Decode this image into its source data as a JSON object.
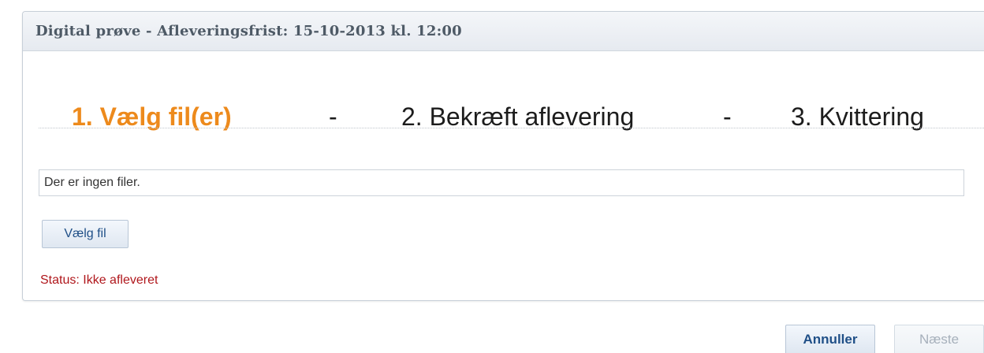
{
  "dialog": {
    "title": "Digital prøve - Afleveringsfrist: 15-10-2013 kl. 12:00"
  },
  "steps": [
    {
      "label": "1. Vælg fil(er)",
      "active": true
    },
    {
      "label": "2. Bekræft aflevering",
      "active": false
    },
    {
      "label": "3. Kvittering",
      "active": false
    }
  ],
  "step_separator": "-",
  "files": {
    "empty_text": "Der er ingen filer."
  },
  "choose_file_button": "Vælg fil",
  "status": "Status: Ikke afleveret",
  "footer": {
    "cancel_label": "Annuller",
    "next_label": "Næste",
    "next_enabled": false
  },
  "colors": {
    "active_step": "#ed8a1c",
    "status_text": "#b0171c",
    "button_text": "#1f4f87"
  }
}
